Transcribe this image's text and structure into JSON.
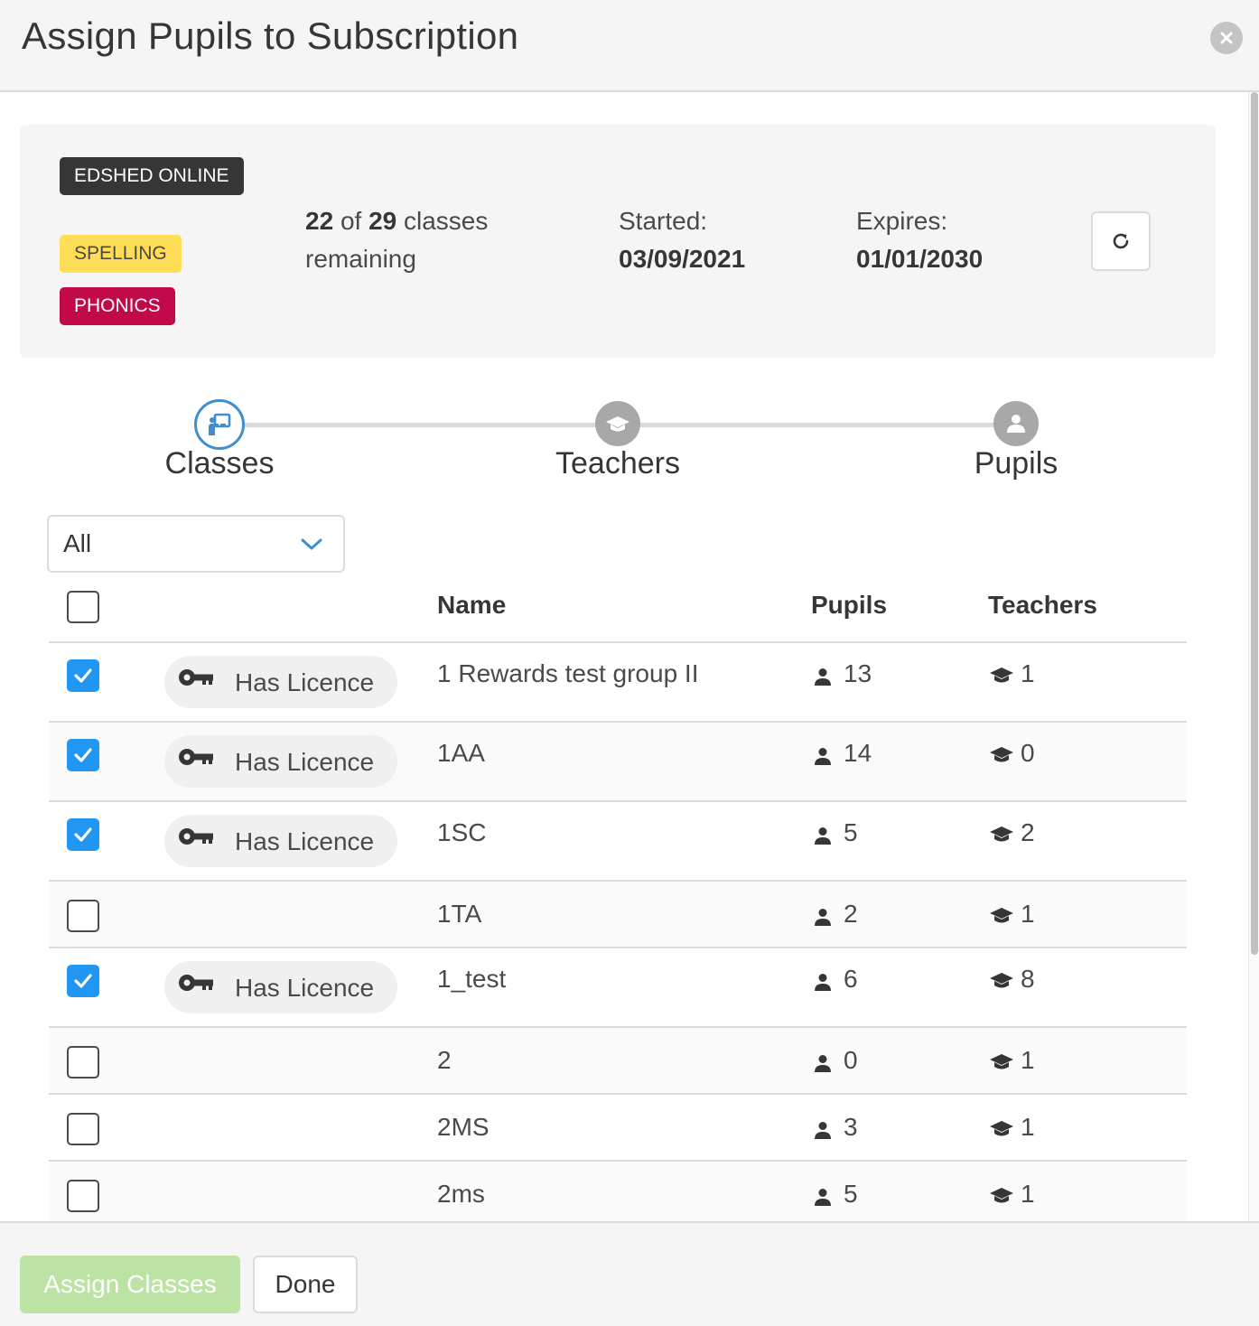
{
  "modal": {
    "title": "Assign Pupils to Subscription"
  },
  "subscription": {
    "tags": [
      "EDSHED ONLINE",
      "SPELLING",
      "PHONICS"
    ],
    "used": "22",
    "of_label": "of",
    "total": "29",
    "remaining_text": "classes remaining",
    "started_label": "Started:",
    "started_date": "03/09/2021",
    "expires_label": "Expires:",
    "expires_date": "01/01/2030"
  },
  "steps": [
    "Classes",
    "Teachers",
    "Pupils"
  ],
  "filter": {
    "value": "All"
  },
  "table": {
    "headers": {
      "name": "Name",
      "pupils": "Pupils",
      "teachers": "Teachers"
    },
    "licence_label": "Has Licence",
    "rows": [
      {
        "checked": true,
        "licence": true,
        "name": "1 Rewards test group II",
        "pupils": "13",
        "teachers": "1"
      },
      {
        "checked": true,
        "licence": true,
        "name": "1AA",
        "pupils": "14",
        "teachers": "0"
      },
      {
        "checked": true,
        "licence": true,
        "name": "1SC",
        "pupils": "5",
        "teachers": "2"
      },
      {
        "checked": false,
        "licence": false,
        "name": "1TA",
        "pupils": "2",
        "teachers": "1"
      },
      {
        "checked": true,
        "licence": true,
        "name": "1_test",
        "pupils": "6",
        "teachers": "8"
      },
      {
        "checked": false,
        "licence": false,
        "name": "2",
        "pupils": "0",
        "teachers": "1"
      },
      {
        "checked": false,
        "licence": false,
        "name": "2MS",
        "pupils": "3",
        "teachers": "1"
      },
      {
        "checked": false,
        "licence": false,
        "name": "2ms",
        "pupils": "5",
        "teachers": "1"
      }
    ]
  },
  "footer": {
    "assign_label": "Assign Classes",
    "done_label": "Done"
  },
  "colors": {
    "checkbox_on": "#2196f3",
    "step_active": "#3e8ed0",
    "assign_button": "#bde3a4",
    "phonics_tag": "#c2094a",
    "spelling_tag": "#ffdd57"
  }
}
